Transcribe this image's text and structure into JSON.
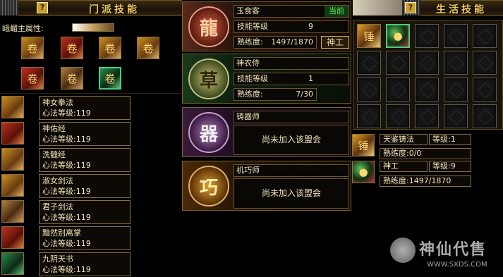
{
  "left_panel": {
    "title": "门派技能",
    "help": "?",
    "attr_label": "峨嵋主属性:",
    "top_icons": [
      "book-icon",
      "scroll-icon",
      "scroll-icon",
      "book-icon",
      "book-icon",
      "scroll-icon",
      "scroll-icon",
      "green-scroll-icon"
    ],
    "skills": [
      {
        "name": "神女拳法",
        "level": "心法等级:119",
        "icon": "book-icon"
      },
      {
        "name": "神佑经",
        "level": "心法等级:119",
        "icon": "scroll-icon"
      },
      {
        "name": "洗髓经",
        "level": "心法等级:119",
        "icon": "book-icon"
      },
      {
        "name": "淑女剑法",
        "level": "心法等级:119",
        "icon": "book-icon"
      },
      {
        "name": "君子剑法",
        "level": "心法等级:119",
        "icon": "scroll-icon"
      },
      {
        "name": "黯然别离掌",
        "level": "心法等级:119",
        "icon": "book-icon"
      },
      {
        "name": "九阴天书",
        "level": "心法等级:119",
        "icon": "green-scroll-icon"
      }
    ]
  },
  "professions": [
    {
      "name": "玉食客",
      "status": "当前",
      "skill_level_label": "技能等级",
      "skill_level": "9",
      "proficiency_label": "熟练度:",
      "proficiency": "1497/1870",
      "title_badge": "神工",
      "emblem": "dragon-emblem-icon"
    },
    {
      "name": "神农侍",
      "skill_level_label": "技能等级",
      "skill_level": "1",
      "proficiency_label": "熟练度:",
      "proficiency": "7/30",
      "emblem": "herb-emblem-icon"
    },
    {
      "name": "铸器师",
      "message": "尚未加入该盟会",
      "emblem": "forge-emblem-icon"
    },
    {
      "name": "机巧师",
      "message": "尚未加入该盟会",
      "emblem": "gear-emblem-icon"
    }
  ],
  "right_panel": {
    "title": "生活技能",
    "help": "?",
    "life_skill_1": {
      "name": "天鉴铸法",
      "level": "等级:1",
      "proficiency": "熟练度:0/0"
    },
    "life_skill_2": {
      "name": "神工",
      "level": "等级:9",
      "proficiency": "熟练度:1497/1870"
    }
  },
  "watermark": {
    "text": "神仙代售",
    "url": "WWW.SXDS.COM"
  }
}
